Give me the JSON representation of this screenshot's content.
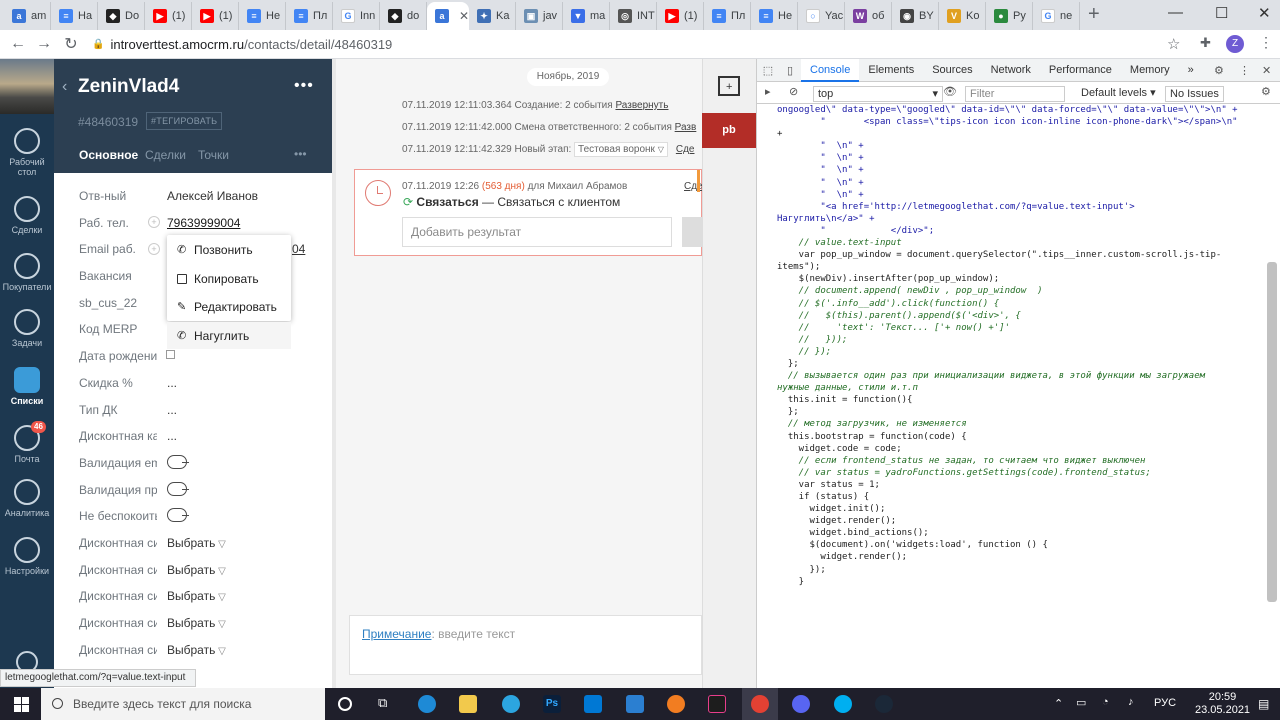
{
  "browser": {
    "tabs": [
      {
        "title": "am",
        "color": "#3b76d8",
        "glyph": "a"
      },
      {
        "title": "Ha",
        "color": "#4285f4",
        "glyph": "≡"
      },
      {
        "title": "Do",
        "color": "#222222",
        "glyph": "◆"
      },
      {
        "title": "(1)",
        "color": "#ff0000",
        "glyph": "▶"
      },
      {
        "title": "(1)",
        "color": "#ff0000",
        "glyph": "▶"
      },
      {
        "title": "He",
        "color": "#4285f4",
        "glyph": "≡"
      },
      {
        "title": "Пл",
        "color": "#4285f4",
        "glyph": "≡"
      },
      {
        "title": "Inn",
        "color": "#ffffff",
        "glyph": "G"
      },
      {
        "title": "do",
        "color": "#222222",
        "glyph": "◆"
      },
      {
        "title": "",
        "color": "#3b76d8",
        "glyph": "a",
        "active": true
      },
      {
        "title": "Ka",
        "color": "#3f6fb5",
        "glyph": "✦"
      },
      {
        "title": "jav",
        "color": "#6c8fb3",
        "glyph": "▣"
      },
      {
        "title": "ma",
        "color": "#3a6ee8",
        "glyph": "▼"
      },
      {
        "title": "INT",
        "color": "#555555",
        "glyph": "◎"
      },
      {
        "title": "(1)",
        "color": "#ff0000",
        "glyph": "▶"
      },
      {
        "title": "Пл",
        "color": "#4285f4",
        "glyph": "≡"
      },
      {
        "title": "He",
        "color": "#4285f4",
        "glyph": "≡"
      },
      {
        "title": "Yac",
        "color": "#ffffff",
        "glyph": "○"
      },
      {
        "title": "об",
        "color": "#7b3fa0",
        "glyph": "W"
      },
      {
        "title": "BY",
        "color": "#444444",
        "glyph": "◉"
      },
      {
        "title": "Ko",
        "color": "#e0a020",
        "glyph": "V"
      },
      {
        "title": "Py",
        "color": "#2b8a3e",
        "glyph": "●"
      },
      {
        "title": "ne",
        "color": "#ffffff",
        "glyph": "G"
      }
    ],
    "new_tab": "+",
    "window_controls": [
      "—",
      "☐",
      "✕"
    ],
    "url_host": "introverttest.amocrm.ru",
    "url_path": "/contacts/detail/48460319",
    "status_url": "letmegooglethat.com/?q=value.text-input"
  },
  "amo_nav": [
    {
      "label": "Рабочий стол",
      "icon": "dashboard-icon"
    },
    {
      "label": "Сделки",
      "icon": "dollar-icon"
    },
    {
      "label": "Покупатели",
      "icon": "customers-icon"
    },
    {
      "label": "Задачи",
      "icon": "check-icon"
    },
    {
      "label": "Списки",
      "icon": "lists-icon",
      "active": true
    },
    {
      "label": "Почта",
      "icon": "mail-icon",
      "badge": "46"
    },
    {
      "label": "Аналитика",
      "icon": "analytics-icon"
    },
    {
      "label": "Настройки",
      "icon": "settings-icon"
    }
  ],
  "contact": {
    "name": "ZeninVlad4",
    "id": "#48460319",
    "tag_button": "#ТЕГИРОВАТЬ",
    "tabs": [
      "Основное",
      "Сделки",
      "Точки"
    ],
    "fields": [
      {
        "label": "Отв-ный",
        "value": "Алексей Иванов",
        "kind": "text"
      },
      {
        "label": "Раб. тел.",
        "value": "79639999004",
        "kind": "link"
      },
      {
        "label": "Email раб.",
        "value": "",
        "kind": "text"
      },
      {
        "label": "Вакансия",
        "value": "",
        "kind": "text"
      },
      {
        "label": "sb_cus_22",
        "value": "",
        "kind": "text"
      },
      {
        "label": "Код MERP",
        "value": "",
        "kind": "text"
      },
      {
        "label": "Дата рождения",
        "value": "",
        "kind": "date"
      },
      {
        "label": "Скидка %",
        "value": "...",
        "kind": "text"
      },
      {
        "label": "Тип ДК",
        "value": "...",
        "kind": "text"
      },
      {
        "label": "Дисконтная карта",
        "value": "...",
        "kind": "text"
      },
      {
        "label": "Валидация email",
        "value": "",
        "kind": "toggle"
      },
      {
        "label": "Валидация проверки",
        "value": "",
        "kind": "toggle"
      },
      {
        "label": "Не беспокоить",
        "value": "",
        "kind": "toggle"
      },
      {
        "label": "Дисконтная система",
        "value": "Выбрать",
        "kind": "select"
      },
      {
        "label": "Дисконтная система",
        "value": "Выбрать",
        "kind": "select"
      },
      {
        "label": "Дисконтная система",
        "value": "Выбрать",
        "kind": "select"
      },
      {
        "label": "Дисконтная система",
        "value": "Выбрать",
        "kind": "select"
      },
      {
        "label": "Дисконтная система",
        "value": "Выбрать",
        "kind": "select"
      }
    ],
    "email_partial": "04"
  },
  "context_menu": [
    "Позвонить",
    "Копировать",
    "Редактировать",
    "Нагуглить"
  ],
  "feed": {
    "date_pill": "Ноябрь, 2019",
    "events": [
      {
        "text": "07.11.2019 12:11:03.364 Создание: 2 события ",
        "link": "Развернуть"
      },
      {
        "text": "07.11.2019 12:11:42.000 Смена ответственного: 2 события ",
        "link": "Разв"
      },
      {
        "text": "07.11.2019 12:11:42.329 Новый этап: ",
        "link": "Сде"
      }
    ],
    "pipeline_select": "Тестовая воронк",
    "task": {
      "date": "07.11.2019 12:26",
      "overdue": "(563 дня)",
      "for": " для Михаил Абрамов",
      "title": "Связаться",
      "desc": " — Связаться с клиентом",
      "right_link": "Сде",
      "placeholder": "Добавить результат"
    },
    "note_link": "Примечание",
    "note_placeholder": ": введите текст"
  },
  "widget": {
    "pb_label": "pb"
  },
  "devtools": {
    "tabs": [
      "Console",
      "Elements",
      "Sources",
      "Network",
      "Performance",
      "Memory",
      "»"
    ],
    "context": "top",
    "filter": "Filter",
    "levels": "Default levels ▾",
    "issues": "No Issues",
    "code": [
      "ongoogled\\\" data-type=\\\"googled\\\" data-id=\\\"\\\" data-forced=\\\"\\\" data-value=\\\"\\\">\\n\" +",
      "        \"       <span class=\\\"tips-icon icon icon-inline icon-phone-dark\\\"></span>\\n\"",
      "+",
      "        \"  \\n\" +",
      "        \"  \\n\" +",
      "        \"  \\n\" +",
      "        \"  \\n\" +",
      "        \"  \\n\" +",
      "        \"<a href='http://letmegooglethat.com/?q=value.text-input'>",
      "Нагуглить\\n</a>\" +",
      "        \"            </div>\";",
      "",
      "    // value.text-input",
      "    var pop_up_window = document.querySelector(\".tips__inner.custom-scroll.js-tip-",
      "items\");",
      "    $(newDiv).insertAfter(pop_up_window);",
      "    // document.append( newDiv , pop_up_window  )",
      "",
      "",
      "",
      "    // $('.info__add').click(function() {",
      "    //   $(this).parent().append($('<div>', {",
      "    //     'text': 'Текст... ['+ now() +']'",
      "    //   }));",
      "    // });",
      "",
      "  };",
      "",
      "  // вызывается один раз при инициализации виджета, в этой функции мы загружаем",
      "нужные данные, стили и.т.п",
      "  this.init = function(){",
      "",
      "  };",
      "",
      "  // метод загрузчик, не изменяется",
      "  this.bootstrap = function(code) {",
      "    widget.code = code;",
      "    // если frontend_status не задан, то считаем что виджет выключен",
      "    // var status = yadroFunctions.getSettings(code).frontend_status;",
      "    var status = 1;",
      "",
      "    if (status) {",
      "      widget.init();",
      "      widget.render();",
      "      widget.bind_actions();",
      "      $(document).on('widgets:load', function () {",
      "        widget.render();",
      "      });",
      "    }"
    ]
  },
  "taskbar": {
    "search_placeholder": "Введите здесь текст для поиска",
    "lang": "РУС",
    "time": "20:59",
    "date": "23.05.2021"
  }
}
